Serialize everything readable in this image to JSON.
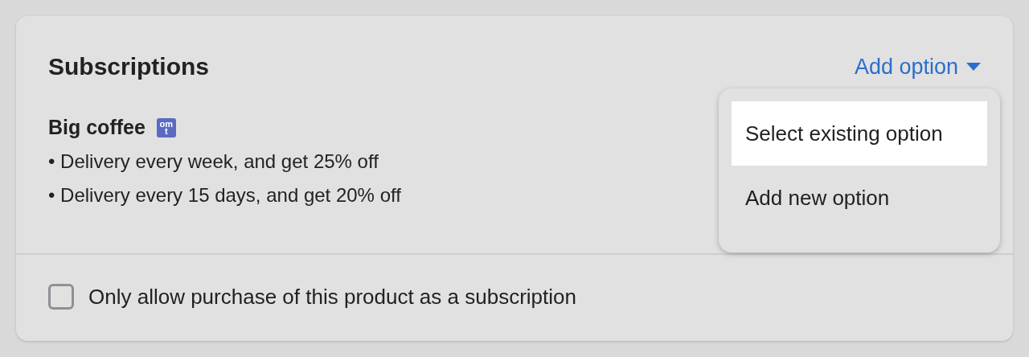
{
  "card": {
    "title": "Subscriptions",
    "action": {
      "label": "Add option",
      "expanded": true
    },
    "plan": {
      "name": "Big coffee",
      "badge": {
        "top": "om",
        "bottom": "t"
      },
      "items": [
        "Delivery every week, and get 25% off",
        "Delivery every 15 days, and get 20% off"
      ],
      "bullet": "•"
    },
    "menu": [
      {
        "label": "Select existing option",
        "selected": true
      },
      {
        "label": "Add new option",
        "selected": false
      }
    ],
    "footer": {
      "label": "Only allow purchase of this product as a subscription",
      "checked": false
    }
  }
}
